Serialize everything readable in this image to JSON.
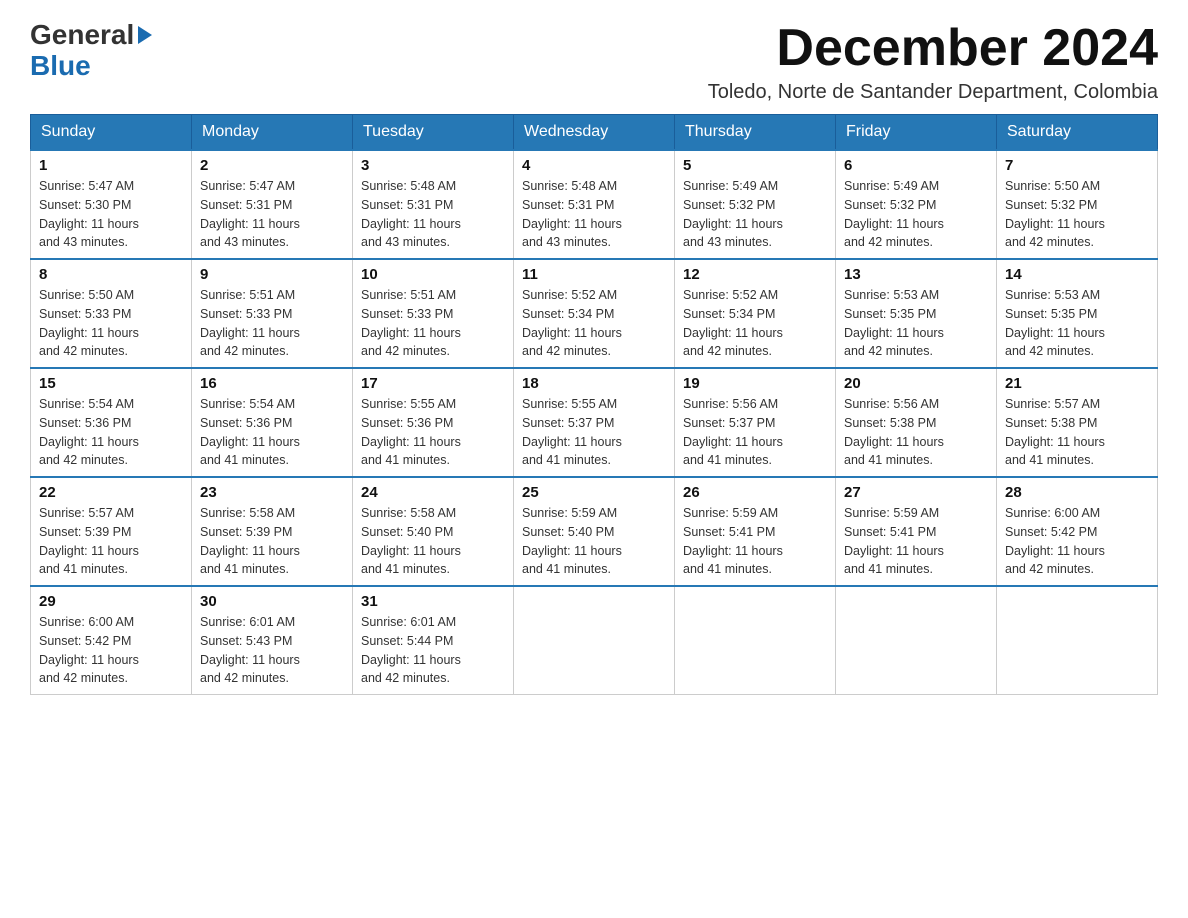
{
  "logo": {
    "line1": "General",
    "line2": "Blue"
  },
  "title": {
    "month_year": "December 2024",
    "location": "Toledo, Norte de Santander Department, Colombia"
  },
  "header": {
    "days": [
      "Sunday",
      "Monday",
      "Tuesday",
      "Wednesday",
      "Thursday",
      "Friday",
      "Saturday"
    ]
  },
  "weeks": [
    {
      "cells": [
        {
          "day": "1",
          "info": "Sunrise: 5:47 AM\nSunset: 5:30 PM\nDaylight: 11 hours\nand 43 minutes."
        },
        {
          "day": "2",
          "info": "Sunrise: 5:47 AM\nSunset: 5:31 PM\nDaylight: 11 hours\nand 43 minutes."
        },
        {
          "day": "3",
          "info": "Sunrise: 5:48 AM\nSunset: 5:31 PM\nDaylight: 11 hours\nand 43 minutes."
        },
        {
          "day": "4",
          "info": "Sunrise: 5:48 AM\nSunset: 5:31 PM\nDaylight: 11 hours\nand 43 minutes."
        },
        {
          "day": "5",
          "info": "Sunrise: 5:49 AM\nSunset: 5:32 PM\nDaylight: 11 hours\nand 43 minutes."
        },
        {
          "day": "6",
          "info": "Sunrise: 5:49 AM\nSunset: 5:32 PM\nDaylight: 11 hours\nand 42 minutes."
        },
        {
          "day": "7",
          "info": "Sunrise: 5:50 AM\nSunset: 5:32 PM\nDaylight: 11 hours\nand 42 minutes."
        }
      ]
    },
    {
      "cells": [
        {
          "day": "8",
          "info": "Sunrise: 5:50 AM\nSunset: 5:33 PM\nDaylight: 11 hours\nand 42 minutes."
        },
        {
          "day": "9",
          "info": "Sunrise: 5:51 AM\nSunset: 5:33 PM\nDaylight: 11 hours\nand 42 minutes."
        },
        {
          "day": "10",
          "info": "Sunrise: 5:51 AM\nSunset: 5:33 PM\nDaylight: 11 hours\nand 42 minutes."
        },
        {
          "day": "11",
          "info": "Sunrise: 5:52 AM\nSunset: 5:34 PM\nDaylight: 11 hours\nand 42 minutes."
        },
        {
          "day": "12",
          "info": "Sunrise: 5:52 AM\nSunset: 5:34 PM\nDaylight: 11 hours\nand 42 minutes."
        },
        {
          "day": "13",
          "info": "Sunrise: 5:53 AM\nSunset: 5:35 PM\nDaylight: 11 hours\nand 42 minutes."
        },
        {
          "day": "14",
          "info": "Sunrise: 5:53 AM\nSunset: 5:35 PM\nDaylight: 11 hours\nand 42 minutes."
        }
      ]
    },
    {
      "cells": [
        {
          "day": "15",
          "info": "Sunrise: 5:54 AM\nSunset: 5:36 PM\nDaylight: 11 hours\nand 42 minutes."
        },
        {
          "day": "16",
          "info": "Sunrise: 5:54 AM\nSunset: 5:36 PM\nDaylight: 11 hours\nand 41 minutes."
        },
        {
          "day": "17",
          "info": "Sunrise: 5:55 AM\nSunset: 5:36 PM\nDaylight: 11 hours\nand 41 minutes."
        },
        {
          "day": "18",
          "info": "Sunrise: 5:55 AM\nSunset: 5:37 PM\nDaylight: 11 hours\nand 41 minutes."
        },
        {
          "day": "19",
          "info": "Sunrise: 5:56 AM\nSunset: 5:37 PM\nDaylight: 11 hours\nand 41 minutes."
        },
        {
          "day": "20",
          "info": "Sunrise: 5:56 AM\nSunset: 5:38 PM\nDaylight: 11 hours\nand 41 minutes."
        },
        {
          "day": "21",
          "info": "Sunrise: 5:57 AM\nSunset: 5:38 PM\nDaylight: 11 hours\nand 41 minutes."
        }
      ]
    },
    {
      "cells": [
        {
          "day": "22",
          "info": "Sunrise: 5:57 AM\nSunset: 5:39 PM\nDaylight: 11 hours\nand 41 minutes."
        },
        {
          "day": "23",
          "info": "Sunrise: 5:58 AM\nSunset: 5:39 PM\nDaylight: 11 hours\nand 41 minutes."
        },
        {
          "day": "24",
          "info": "Sunrise: 5:58 AM\nSunset: 5:40 PM\nDaylight: 11 hours\nand 41 minutes."
        },
        {
          "day": "25",
          "info": "Sunrise: 5:59 AM\nSunset: 5:40 PM\nDaylight: 11 hours\nand 41 minutes."
        },
        {
          "day": "26",
          "info": "Sunrise: 5:59 AM\nSunset: 5:41 PM\nDaylight: 11 hours\nand 41 minutes."
        },
        {
          "day": "27",
          "info": "Sunrise: 5:59 AM\nSunset: 5:41 PM\nDaylight: 11 hours\nand 41 minutes."
        },
        {
          "day": "28",
          "info": "Sunrise: 6:00 AM\nSunset: 5:42 PM\nDaylight: 11 hours\nand 42 minutes."
        }
      ]
    },
    {
      "cells": [
        {
          "day": "29",
          "info": "Sunrise: 6:00 AM\nSunset: 5:42 PM\nDaylight: 11 hours\nand 42 minutes."
        },
        {
          "day": "30",
          "info": "Sunrise: 6:01 AM\nSunset: 5:43 PM\nDaylight: 11 hours\nand 42 minutes."
        },
        {
          "day": "31",
          "info": "Sunrise: 6:01 AM\nSunset: 5:44 PM\nDaylight: 11 hours\nand 42 minutes."
        },
        {
          "day": "",
          "info": ""
        },
        {
          "day": "",
          "info": ""
        },
        {
          "day": "",
          "info": ""
        },
        {
          "day": "",
          "info": ""
        }
      ]
    }
  ]
}
